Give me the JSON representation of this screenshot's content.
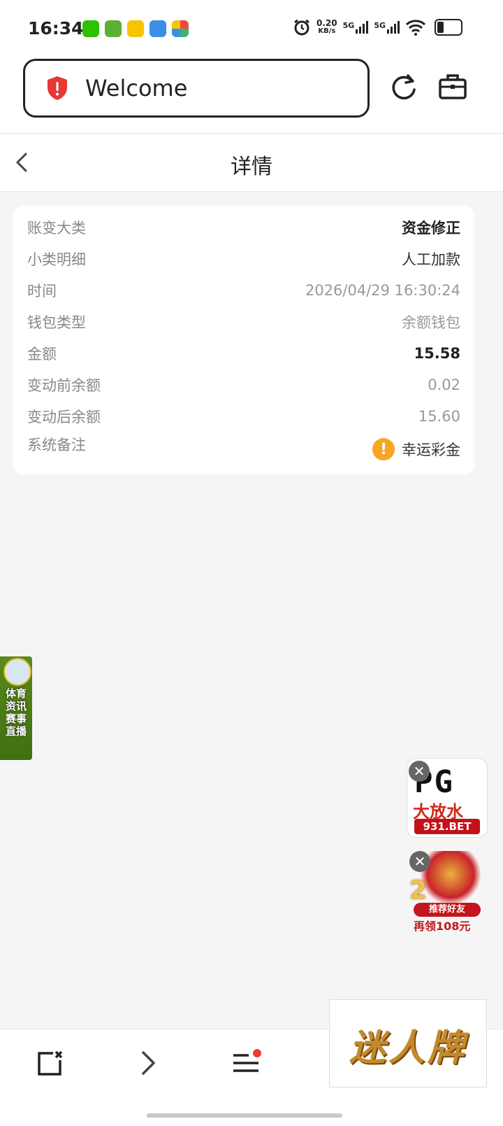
{
  "status_bar": {
    "time": "16:34",
    "net_speed_value": "0.20",
    "net_speed_unit": "KB/s",
    "signal1": "5G",
    "signal2": "5G",
    "app_icons": [
      "wechat-icon",
      "task-check-icon",
      "lottery-app-icon",
      "browser-b-icon",
      "pinwheel-app-icon"
    ]
  },
  "browser": {
    "url_text": "Welcome",
    "security_icon": "shield-alert-icon",
    "reload_icon": "reload-icon",
    "toolbox_icon": "toolbox-icon"
  },
  "page": {
    "title": "详情",
    "back_icon": "chevron-left-icon"
  },
  "detail": {
    "rows": [
      {
        "label": "账变大类",
        "value": "资金修正"
      },
      {
        "label": "小类明细",
        "value": "人工加款"
      },
      {
        "label": "时间",
        "value": "2026/04/29 16:30:24"
      },
      {
        "label": "钱包类型",
        "value": "余额钱包"
      },
      {
        "label": "金额",
        "value": "15.58"
      },
      {
        "label": "变动前余额",
        "value": "0.02"
      },
      {
        "label": "变动后余额",
        "value": "15.60"
      },
      {
        "label": "系统备注",
        "value": "幸运彩金"
      }
    ]
  },
  "ads": {
    "left_banner": "体育资讯赛事直播",
    "pg_logo": "PG",
    "pg_sub": "大放水",
    "pg_url": "931.BET",
    "refer_number": "2",
    "refer_pill": "推荐好友",
    "refer_bonus": "再领108元",
    "brand": "迷人牌",
    "close_glyph": "✕"
  },
  "bottom_nav": {
    "icons": [
      "close-tab-icon",
      "forward-icon",
      "menu-icon"
    ]
  },
  "colors": {
    "accent_warning": "#f5a623",
    "security_red": "#e53935",
    "badge_red": "#f03a3a"
  }
}
